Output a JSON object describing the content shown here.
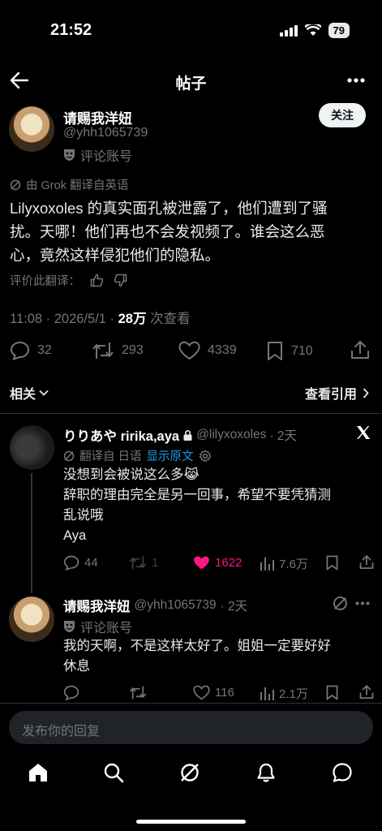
{
  "status_bar": {
    "time": "21:52",
    "battery": "79"
  },
  "header": {
    "title": "帖子"
  },
  "post": {
    "author_name": "请赐我洋妞",
    "author_handle": "@yhh1065739",
    "account_label": "评论账号",
    "follow_label": "关注",
    "translated_from": "由 Grok 翻译自英语",
    "text_lines": [
      "Lilyxoxoles 的真实面孔被泄露了，他们遭到了骚",
      "扰。天哪！他们再也不会发视频了。谁会这么恶",
      "心，竟然这样侵犯他们的隐私。"
    ],
    "rate_translation": "评价此翻译：",
    "timestamp": "11:08 · 2026/5/1 · ",
    "views": "28万",
    "views_label": "次查看",
    "replies": "32",
    "reposts": "293",
    "likes": "4339",
    "bookmarks": "710"
  },
  "related": {
    "label": "相关",
    "quotes_label": "查看引用"
  },
  "reply1": {
    "author_name": "りりあや ririka,aya",
    "author_handle": "@lilyxoxoles",
    "time": "· 2天",
    "translated_from": "翻译自 日语",
    "show_original": "显示原文",
    "text_lines": [
      "没想到会被说这么多😹",
      "辞职的理由完全是另一回事，希望不要凭猜测",
      "乱说哦",
      "Aya"
    ],
    "replies": "44",
    "reposts": "1",
    "likes": "1622",
    "views": "7.6万"
  },
  "reply2": {
    "author_name": "请赐我洋妞",
    "author_handle": "@yhh1065739",
    "time": "· 2天",
    "account_label": "评论账号",
    "text_lines": [
      "我的天啊，不是这样太好了。姐姐一定要好好",
      "休息"
    ],
    "likes": "116",
    "views": "2.1万"
  },
  "composer": {
    "placeholder": "发布你的回复"
  },
  "colors": {
    "like_active": "#f91880",
    "link": "#1d9bf0",
    "muted": "#71767b"
  },
  "icons": [
    "back-arrow-icon",
    "more-icon",
    "mask-icon",
    "grok-icon",
    "thumbs-up-icon",
    "thumbs-down-icon",
    "reply-icon",
    "repost-icon",
    "like-icon",
    "bookmark-icon",
    "share-icon",
    "chevron-down-icon",
    "chevron-right-icon",
    "lock-icon",
    "x-logo-icon",
    "translate-icon",
    "gear-icon",
    "views-icon",
    "home-icon",
    "search-icon",
    "grok-tab-icon",
    "bell-icon",
    "messages-icon"
  ]
}
